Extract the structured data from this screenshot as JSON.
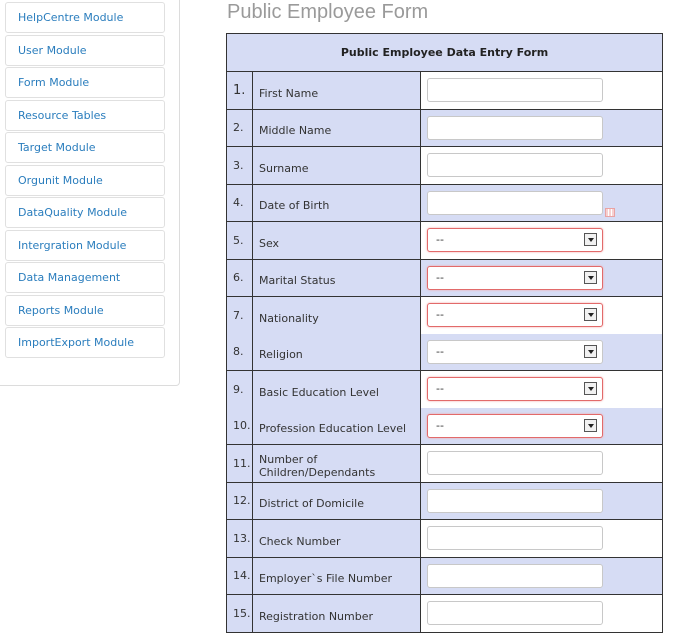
{
  "sidebar": {
    "items": [
      {
        "label": "HelpCentre Module"
      },
      {
        "label": "User Module"
      },
      {
        "label": "Form Module"
      },
      {
        "label": "Resource Tables"
      },
      {
        "label": "Target Module"
      },
      {
        "label": "Orgunit Module"
      },
      {
        "label": "DataQuality Module"
      },
      {
        "label": "Intergration Module"
      },
      {
        "label": "Data Management"
      },
      {
        "label": "Reports Module"
      },
      {
        "label": "ImportExport Module"
      }
    ]
  },
  "page": {
    "title": "Public Employee Form"
  },
  "form": {
    "header": "Public Employee Data Entry Form",
    "rows": [
      {
        "num": "1.",
        "label": "First Name",
        "value": ""
      },
      {
        "num": "2.",
        "label": "Middle Name",
        "value": ""
      },
      {
        "num": "3.",
        "label": "Surname",
        "value": ""
      },
      {
        "num": "4.",
        "label": "Date of Birth",
        "value": ""
      },
      {
        "num": "5.",
        "label": "Sex",
        "value": "--"
      },
      {
        "num": "6.",
        "label": "Marital Status",
        "value": "--"
      },
      {
        "num": "7.",
        "label": "Nationality",
        "value": "--"
      },
      {
        "num": "8.",
        "label": "Religion",
        "value": "--"
      },
      {
        "num": "9.",
        "label": "Basic Education Level",
        "value": "--"
      },
      {
        "num": "10.",
        "label": "Profession Education Level",
        "value": "--"
      },
      {
        "num": "11.",
        "label": "Number of Children/Dependants",
        "value": ""
      },
      {
        "num": "12.",
        "label": "District of Domicile",
        "value": ""
      },
      {
        "num": "13.",
        "label": "Check Number",
        "value": ""
      },
      {
        "num": "14.",
        "label": "Employer`s File Number",
        "value": ""
      },
      {
        "num": "15.",
        "label": "Registration Number",
        "value": ""
      }
    ]
  }
}
